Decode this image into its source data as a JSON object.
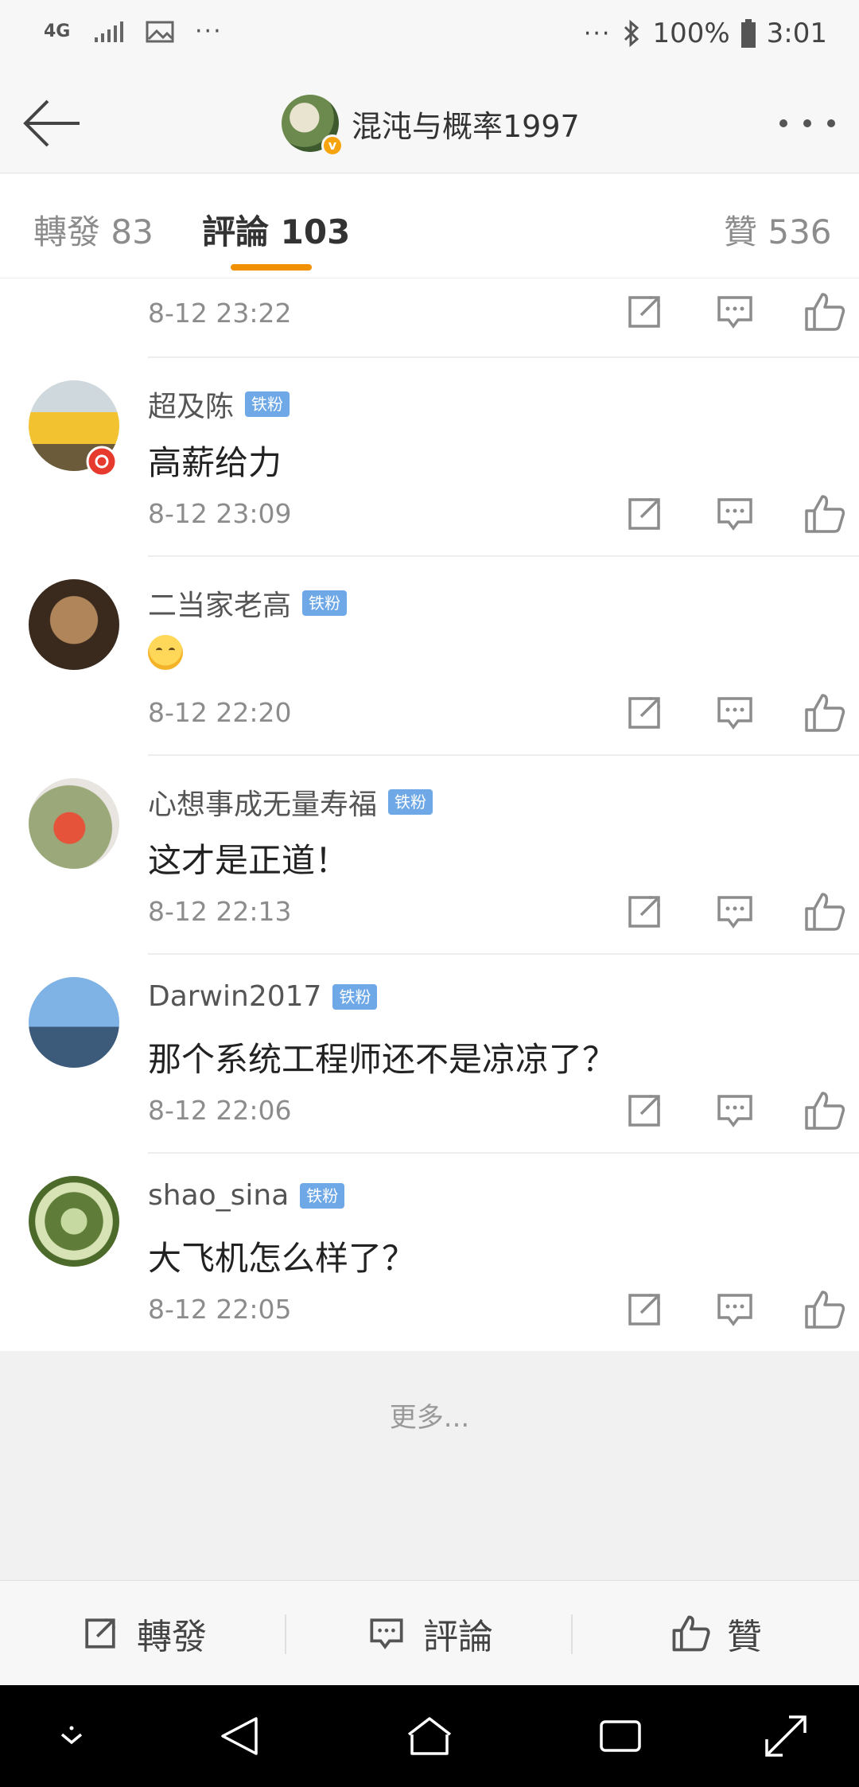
{
  "status_bar": {
    "network": "4G",
    "more_left": "···",
    "more_right": "···",
    "battery": "100%",
    "time": "3:01"
  },
  "nav": {
    "title": "混沌与概率1997",
    "verified_badge": "v"
  },
  "tabs": [
    {
      "label": "轉發 83"
    },
    {
      "label": "評論 103"
    },
    {
      "label": "贊 536"
    }
  ],
  "comments": [
    {
      "time": "8-12 23:22"
    },
    {
      "username": "超及陈",
      "badge": "铁粉",
      "content": "高薪给力",
      "time": "8-12 23:09"
    },
    {
      "username": "二当家老高",
      "badge": "铁粉",
      "content": "",
      "time": "8-12 22:20"
    },
    {
      "username": "心想事成无量寿福",
      "badge": "铁粉",
      "content": "这才是正道！",
      "time": "8-12 22:13"
    },
    {
      "username": "Darwin2017",
      "badge": "铁粉",
      "content": "那个系统工程师还不是凉凉了？",
      "time": "8-12 22:06"
    },
    {
      "username": "shao_sina",
      "badge": "铁粉",
      "content": "大飞机怎么样了？",
      "time": "8-12 22:05"
    }
  ],
  "more": {
    "label": "更多..."
  },
  "toolbar": {
    "repost": "轉發",
    "comment": "評論",
    "like": "贊"
  },
  "colors": {
    "accent": "#f29100",
    "badge_blue": "#6fa8e6",
    "icon_gray": "#8c8c8c"
  }
}
